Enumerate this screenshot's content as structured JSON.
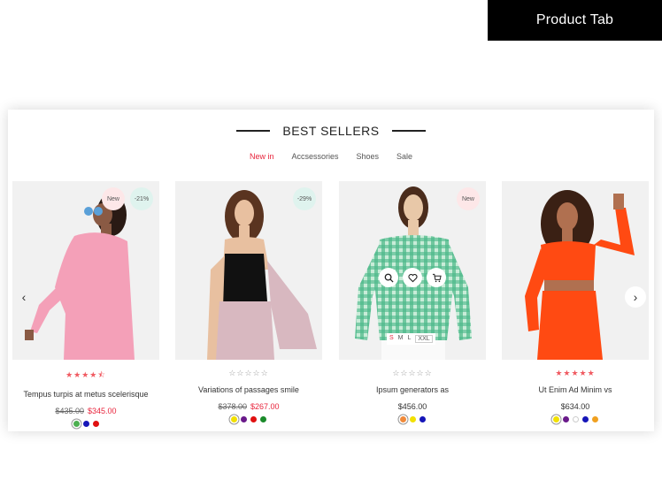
{
  "tag_label": "Product Tab",
  "section_title": "BEST SELLERS",
  "tabs": [
    {
      "label": "New in",
      "active": true
    },
    {
      "label": "Accsessories",
      "active": false
    },
    {
      "label": "Shoes",
      "active": false
    },
    {
      "label": "Sale",
      "active": false
    }
  ],
  "nav": {
    "prev": "‹",
    "next": "›"
  },
  "products": [
    {
      "name": "Tempus turpis at metus scelerisque",
      "old_price": "$435.00",
      "price": "$345.00",
      "rating": 4.5,
      "badges": [
        "New",
        "-21%"
      ],
      "swatches": [
        "#4caf50",
        "#1616b8",
        "#e01010"
      ],
      "selected_swatch": 0
    },
    {
      "name": "Variations of passages smile",
      "old_price": "$378.00",
      "price": "$267.00",
      "rating": 0,
      "badges": [
        "-29%"
      ],
      "swatches": [
        "#f2e000",
        "#6a1a8a",
        "#e01010",
        "#1a8a2a"
      ],
      "selected_swatch": 0
    },
    {
      "name": "Ipsum generators as",
      "old_price": "",
      "price": "$456.00",
      "rating": 0,
      "badges": [
        "New"
      ],
      "swatches": [
        "#f08a3a",
        "#f2e000",
        "#1616b8"
      ],
      "selected_swatch": 0,
      "sizes": [
        "S",
        "M",
        "L",
        "XXL"
      ],
      "active_size": 0,
      "actions": [
        "search-icon",
        "heart-icon",
        "cart-icon"
      ]
    },
    {
      "name": "Ut Enim Ad Minim vs",
      "old_price": "",
      "price": "$634.00",
      "rating": 5,
      "badges": [],
      "swatches": [
        "#f2e000",
        "#6a1a8a",
        "#ffffff",
        "#1616b8",
        "#f0a020"
      ],
      "selected_swatch": 0
    }
  ],
  "colors": {
    "accent": "#e8243c",
    "star": "#f05a61"
  }
}
